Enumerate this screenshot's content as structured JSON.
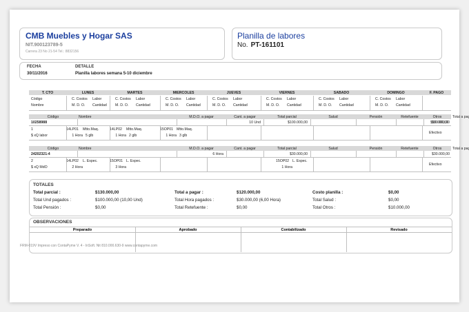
{
  "company": {
    "name": "CMB Muebles y Hogar SAS",
    "nit": "NIT.900123789-5",
    "address": "Carrera 23 No 21-54  Tel.: 8832156"
  },
  "doc": {
    "title": "Planilla de labores",
    "no_label": "No.",
    "no_value": "PT-161101"
  },
  "header": {
    "fecha_label": "FECHA",
    "fecha": "30/11/2016",
    "detalle_label": "DETALLE",
    "detalle": "Planilla labores semana 5-10 diciembre"
  },
  "week": {
    "cols": [
      "T. CTO",
      "LUNES",
      "MARTES",
      "MIERCOLES",
      "JUEVES",
      "VIERNES",
      "SABADO",
      "DOMINGO",
      "F. PAGO"
    ],
    "r1": [
      "Código",
      "C. Costos",
      "Labor"
    ],
    "r2": [
      "Nombre",
      "M. D. O.",
      "Cantidad"
    ]
  },
  "emp_header": [
    "Código",
    "Nombre",
    "M.D.O. a pagar",
    "Cant. a pagar",
    "Total parcial",
    "Salud",
    "Pensión",
    "Retefuente",
    "Otros",
    "Total a pagar"
  ],
  "employees": [
    {
      "code": "10258988",
      "cant": "10 Und",
      "parcial": "$100.000,00",
      "otros": "$10.000,00",
      "total": "$90.000,00",
      "d1": "1",
      "d2": "$ xQ labor",
      "pago": "Efectivo",
      "days": [
        {
          "cc": "14LP01",
          "lab": "Mtto.Maq.",
          "mdo": "1 Hora",
          "cnt": "5 glb"
        },
        {
          "cc": "14LP02",
          "lab": "Mtto.Maq.",
          "mdo": "1 Hora",
          "cnt": "2 glb"
        },
        {
          "cc": "15OP01",
          "lab": "Mtto.Maq.",
          "mdo": "1 Hora",
          "cnt": "3 glb"
        }
      ]
    },
    {
      "code": "24202321-4",
      "mdo": "6 Hora",
      "parcial": "$30.000,00",
      "total": "$30.000,00",
      "d1": "2",
      "d2": "$ xQ MdO",
      "pago": "Efectivo",
      "days": [
        {
          "cc": "14LP02",
          "lab": "L. Espec.",
          "mdo": "2 Hora"
        },
        {
          "cc": "15OP01",
          "lab": "L. Espec.",
          "mdo": "3 Hora"
        },
        {
          "cc": "15OP02",
          "lab": "L. Espec.",
          "mdo": "1 Hora"
        }
      ]
    }
  ],
  "totals": {
    "title": "TOTALES",
    "c1": [
      [
        "Total parcial :",
        "$130.000,00"
      ],
      [
        "Total Und pagados :",
        "$100.000,00 (10,00 Und)"
      ],
      [
        "Total Pensión :",
        "$0,00"
      ]
    ],
    "c2": [
      [
        "Total a pagar :",
        "$120.000,00"
      ],
      [
        "Total Hora pagados :",
        "$30.000,00 (6,00 Hora)"
      ],
      [
        "Total Retefuente :",
        "$0,00"
      ]
    ],
    "c3": [
      [
        "Costo planilla :",
        "$0,00"
      ],
      [
        "Total Salud :",
        "$0,00"
      ],
      [
        "Total Otros :",
        "$10.000,00"
      ]
    ]
  },
  "obs": {
    "title": "OBSERVACIONES",
    "sign": [
      "Preparado",
      "Aprobado",
      "Contabilizado",
      "Revisado"
    ]
  },
  "footer": "FRM-019V   Impreso con ContaPyme V. 4 - InSoft. Nit 810.000.630-9 www.contapyme.com"
}
